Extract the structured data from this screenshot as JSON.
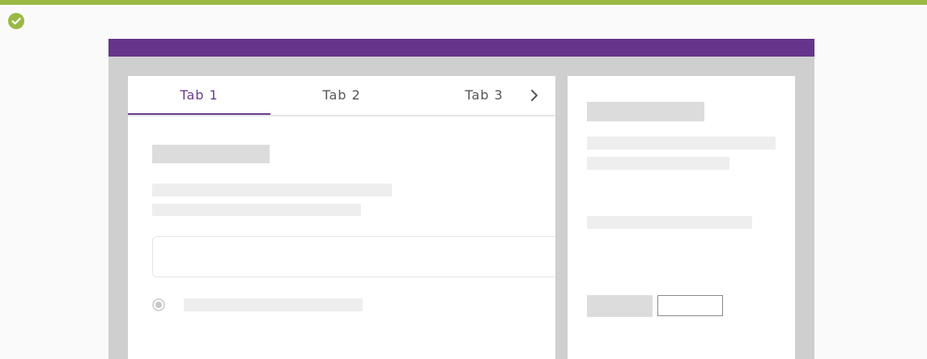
{
  "colors": {
    "top_stripe": "#9ab843",
    "status_icon": "#9ab843",
    "frame_header": "#67348b",
    "tab_active": "#6a3b8d",
    "tab_underline": "#6a3b8d"
  },
  "status": {
    "icon": "check-circle-icon"
  },
  "tabs": [
    {
      "label": "Tab 1",
      "active": true
    },
    {
      "label": "Tab 2",
      "active": false
    },
    {
      "label": "Tab 3",
      "active": false
    }
  ],
  "tabs_scroll_icon": "chevron-right-icon",
  "main_panel": {
    "radio_icon": "radio-selected-icon"
  },
  "side_panel": {}
}
